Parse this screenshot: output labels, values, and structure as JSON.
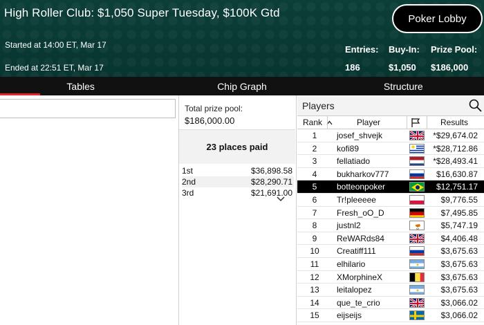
{
  "header": {
    "title": "High Roller Club: $1,050 Super Tuesday, $100K Gtd",
    "started": "Started at 14:00 ET, Mar 17",
    "ended": "Ended at 22:51 ET, Mar 17",
    "lobby_button": "Poker Lobby",
    "stats": {
      "entries_label": "Entries:",
      "entries_value": "186",
      "buyin_label": "Buy-In:",
      "buyin_value": "$1,050",
      "prize_label": "Prize Pool:",
      "prize_value": "$186,000"
    }
  },
  "tabs": [
    {
      "label": "Tables",
      "active": true
    },
    {
      "label": "Chip Graph",
      "active": false
    },
    {
      "label": "Structure",
      "active": false
    }
  ],
  "colors": {
    "header_bg": "#0a3b34",
    "tab_bg": "#111111",
    "accent": "#e3262e",
    "highlight_row": "#000000"
  },
  "prize": {
    "label": "Total prize pool:",
    "value": "$186,000.00",
    "places_paid": "23 places paid",
    "places": [
      {
        "place": "1st",
        "amount": "$36,898.58"
      },
      {
        "place": "2nd",
        "amount": "$28,290.71"
      },
      {
        "place": "3rd",
        "amount": "$21,691.00"
      }
    ]
  },
  "players": {
    "title": "Players",
    "columns": {
      "rank": "Rank",
      "player": "Player",
      "results": "Results"
    },
    "rows": [
      {
        "rank": "1",
        "name": "josef_shvejk",
        "flag": "uk",
        "result": "*$29,674.02"
      },
      {
        "rank": "2",
        "name": "kofi89",
        "flag": "uruguay",
        "result": "*$28,712.86"
      },
      {
        "rank": "3",
        "name": "fellatiado",
        "flag": "netherlands",
        "result": "*$28,493.41"
      },
      {
        "rank": "4",
        "name": "bukharkov777",
        "flag": "russia",
        "result": "$16,630.87"
      },
      {
        "rank": "5",
        "name": "botteonpoker",
        "flag": "brazil",
        "result": "$12,751.17",
        "highlight": true
      },
      {
        "rank": "6",
        "name": "Tr!pleeeee",
        "flag": "poland",
        "result": "$9,776.55"
      },
      {
        "rank": "7",
        "name": "Fresh_oO_D",
        "flag": "germany",
        "result": "$7,495.85"
      },
      {
        "rank": "8",
        "name": "justnl2",
        "flag": "cyprus",
        "result": "$5,747.19"
      },
      {
        "rank": "9",
        "name": "ReWARds84",
        "flag": "uk",
        "result": "$4,406.48"
      },
      {
        "rank": "10",
        "name": "Creatiff111",
        "flag": "russia",
        "result": "$3,675.63"
      },
      {
        "rank": "11",
        "name": "elhilario",
        "flag": "argentina",
        "result": "$3,675.63"
      },
      {
        "rank": "12",
        "name": "XMorphineX",
        "flag": "belgium",
        "result": "$3,675.63"
      },
      {
        "rank": "13",
        "name": "leitalopez",
        "flag": "argentina",
        "result": "$3,675.63"
      },
      {
        "rank": "14",
        "name": "que_te_crio",
        "flag": "uk",
        "result": "$3,066.02"
      },
      {
        "rank": "15",
        "name": "eijseijs",
        "flag": "sweden",
        "result": "$3,066.02"
      }
    ]
  }
}
